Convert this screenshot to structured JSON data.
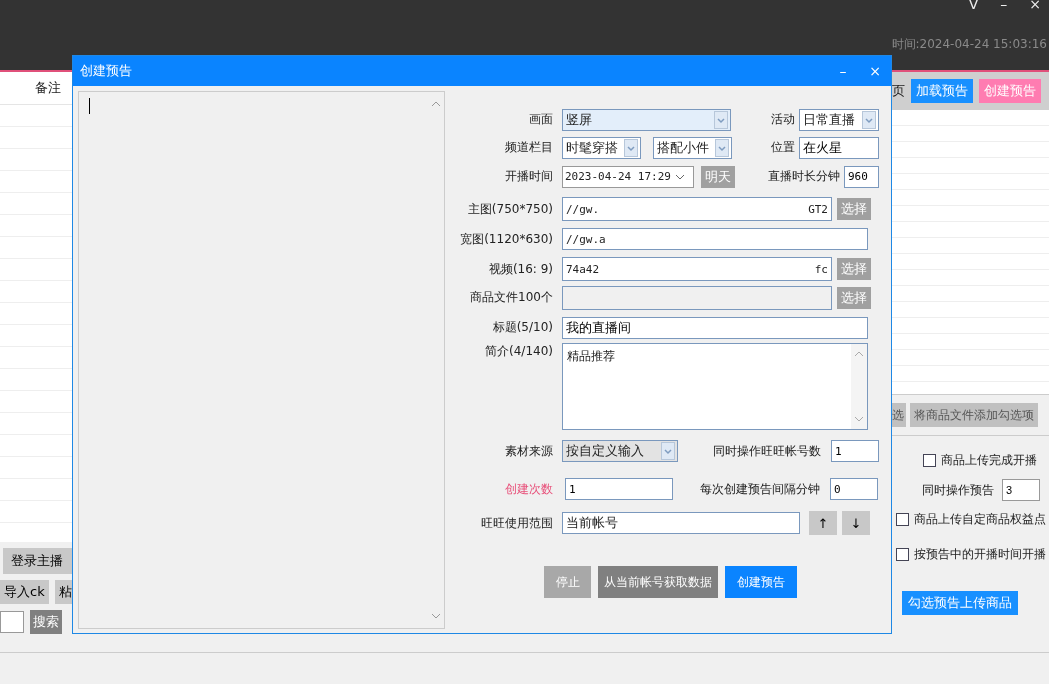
{
  "app_header": {
    "window_controls": [
      "V",
      "–",
      "×"
    ],
    "info": "时间:2024-04-24 15:03:16"
  },
  "left_panel": {
    "column_header": "备注",
    "buttons": [
      "登录主播",
      "导入ck",
      "粘"
    ],
    "search_button": "搜索"
  },
  "right_panel": {
    "page_text": "页",
    "load_button": "加载预告",
    "create_button": "创建预告",
    "buttons": [
      "选",
      "将商品文件添加勾选项"
    ],
    "options": [
      {
        "kind": "checkbox",
        "label": "商品上传完成开播",
        "checked": false
      },
      {
        "kind": "number",
        "label": "同时操作预告",
        "value": "3"
      },
      {
        "kind": "checkbox",
        "label": "商品上传自定商品权益点",
        "checked": false
      },
      {
        "kind": "checkbox",
        "label": "按预告中的开播时间开播",
        "checked": false
      }
    ],
    "upload_button": "勾选预告上传商品"
  },
  "dialog": {
    "title": "创建预告",
    "controls": [
      "–",
      "×"
    ],
    "form": {
      "screen": {
        "label": "画面",
        "value": "竖屏"
      },
      "activity": {
        "label": "活动",
        "value": "日常直播"
      },
      "channel": {
        "label": "频道栏目",
        "values": [
          "时髦穿搭",
          "搭配小件"
        ]
      },
      "location": {
        "label": "位置",
        "value": "在火星"
      },
      "start_time": {
        "label": "开播时间",
        "value": "2023-04-24 17:29",
        "button": "明天"
      },
      "duration": {
        "label": "直播时长分钟",
        "value": "960"
      },
      "main_image": {
        "label": "主图(750*750)",
        "value": "//gw.",
        "value_tail": "GT2",
        "button": "选择"
      },
      "wide_image": {
        "label": "宽图(1120*630)",
        "value": "//gw.a"
      },
      "video": {
        "label": "视频(16: 9)",
        "value": "74a42",
        "value_tail": "fc",
        "button": "选择"
      },
      "product_file": {
        "label": "商品文件100个",
        "button": "选择"
      },
      "title": {
        "label": "标题(5/10)",
        "value": "我的直播间"
      },
      "intro": {
        "label": "简介(4/140)",
        "value": "精品推荐"
      },
      "source": {
        "label": "素材来源",
        "value": "按自定义输入"
      },
      "accounts": {
        "label": "同时操作旺旺帐号数",
        "value": "1"
      },
      "create_count": {
        "label": "创建次数",
        "value": "1",
        "highlighted": true
      },
      "interval": {
        "label": "每次创建预告间隔分钟",
        "value": "0"
      },
      "scope": {
        "label": "旺旺使用范围",
        "value": "当前帐号",
        "up": "↑",
        "down": "↓"
      }
    },
    "actions": [
      {
        "label": "停止",
        "kind": "disabled"
      },
      {
        "label": "从当前帐号获取数据",
        "kind": "secondary"
      },
      {
        "label": "创建预告",
        "kind": "primary"
      }
    ]
  }
}
